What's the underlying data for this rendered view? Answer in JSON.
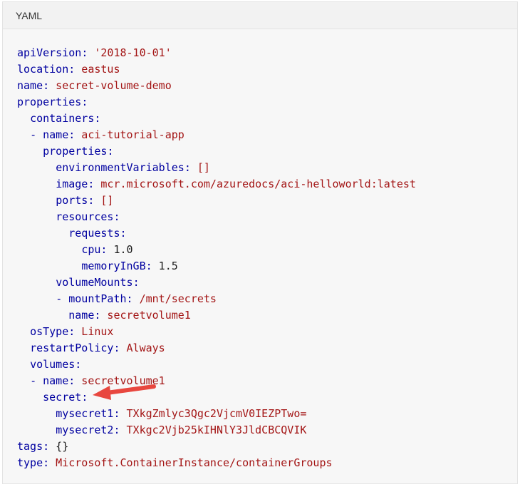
{
  "header": {
    "language_label": "YAML"
  },
  "code_lines": [
    {
      "indent": "",
      "dash": "",
      "key": "apiVersion",
      "value": "'2018-10-01'",
      "value_type": "string"
    },
    {
      "indent": "",
      "dash": "",
      "key": "location",
      "value": "eastus",
      "value_type": "string"
    },
    {
      "indent": "",
      "dash": "",
      "key": "name",
      "value": "secret-volume-demo",
      "value_type": "string"
    },
    {
      "indent": "",
      "dash": "",
      "key": "properties",
      "value": "",
      "value_type": "none"
    },
    {
      "indent": "  ",
      "dash": "",
      "key": "containers",
      "value": "",
      "value_type": "none"
    },
    {
      "indent": "  ",
      "dash": "- ",
      "key": "name",
      "value": "aci-tutorial-app",
      "value_type": "string"
    },
    {
      "indent": "    ",
      "dash": "",
      "key": "properties",
      "value": "",
      "value_type": "none"
    },
    {
      "indent": "      ",
      "dash": "",
      "key": "environmentVariables",
      "value": "[]",
      "value_type": "string"
    },
    {
      "indent": "      ",
      "dash": "",
      "key": "image",
      "value": "mcr.microsoft.com/azuredocs/aci-helloworld:latest",
      "value_type": "string"
    },
    {
      "indent": "      ",
      "dash": "",
      "key": "ports",
      "value": "[]",
      "value_type": "string"
    },
    {
      "indent": "      ",
      "dash": "",
      "key": "resources",
      "value": "",
      "value_type": "none"
    },
    {
      "indent": "        ",
      "dash": "",
      "key": "requests",
      "value": "",
      "value_type": "none"
    },
    {
      "indent": "          ",
      "dash": "",
      "key": "cpu",
      "value": "1.0",
      "value_type": "number"
    },
    {
      "indent": "          ",
      "dash": "",
      "key": "memoryInGB",
      "value": "1.5",
      "value_type": "number"
    },
    {
      "indent": "      ",
      "dash": "",
      "key": "volumeMounts",
      "value": "",
      "value_type": "none"
    },
    {
      "indent": "      ",
      "dash": "- ",
      "key": "mountPath",
      "value": "/mnt/secrets",
      "value_type": "string"
    },
    {
      "indent": "        ",
      "dash": "",
      "key": "name",
      "value": "secretvolume1",
      "value_type": "string"
    },
    {
      "indent": "  ",
      "dash": "",
      "key": "osType",
      "value": "Linux",
      "value_type": "string"
    },
    {
      "indent": "  ",
      "dash": "",
      "key": "restartPolicy",
      "value": "Always",
      "value_type": "string"
    },
    {
      "indent": "  ",
      "dash": "",
      "key": "volumes",
      "value": "",
      "value_type": "none"
    },
    {
      "indent": "  ",
      "dash": "- ",
      "key": "name",
      "value": "secretvolume1",
      "value_type": "string"
    },
    {
      "indent": "    ",
      "dash": "",
      "key": "secret",
      "value": "",
      "value_type": "none"
    },
    {
      "indent": "      ",
      "dash": "",
      "key": "mysecret1",
      "value": "TXkgZmlyc3Qgc2VjcmV0IEZPTwo=",
      "value_type": "string"
    },
    {
      "indent": "      ",
      "dash": "",
      "key": "mysecret2",
      "value": "TXkgc2Vjb25kIHNlY3JldCBCQVIK",
      "value_type": "string"
    },
    {
      "indent": "",
      "dash": "",
      "key": "tags",
      "value": "{}",
      "value_type": "number"
    },
    {
      "indent": "",
      "dash": "",
      "key": "type",
      "value": "Microsoft.ContainerInstance/containerGroups",
      "value_type": "string"
    }
  ],
  "colors": {
    "key": "#0000a0",
    "string_value": "#a31515",
    "arrow": "#e8473f"
  },
  "annotation": {
    "icon": "red-arrow-icon",
    "points_to_line_key": "secret"
  }
}
